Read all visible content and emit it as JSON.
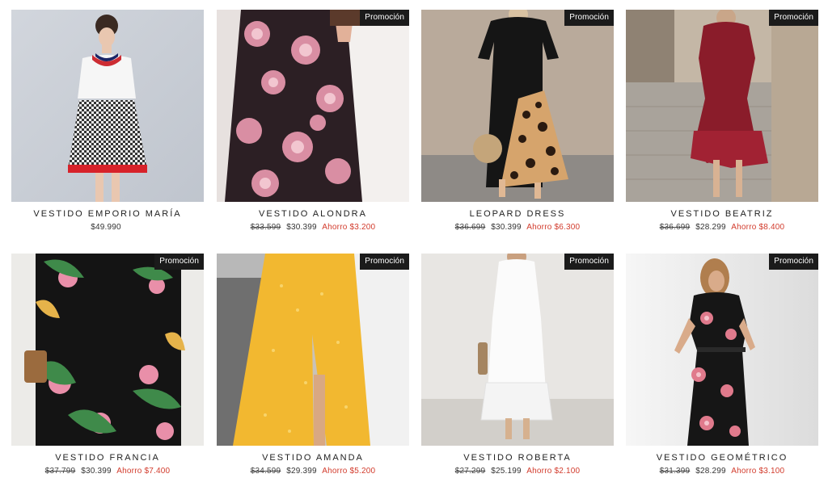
{
  "badge_label": "Promoción",
  "save_label": "Ahorro",
  "colors": {
    "badge_bg": "#1b1b1b",
    "save_text": "#d23b2c"
  },
  "products": [
    {
      "name": "VESTIDO EMPORIO MARÍA",
      "old_price": "",
      "price": "$49.990",
      "save": "",
      "promo": false
    },
    {
      "name": "VESTIDO ALONDRA",
      "old_price": "$33.599",
      "price": "$30.399",
      "save": "$3.200",
      "promo": true
    },
    {
      "name": "LEOPARD DRESS",
      "old_price": "$36.699",
      "price": "$30.399",
      "save": "$6.300",
      "promo": true
    },
    {
      "name": "VESTIDO BEATRIZ",
      "old_price": "$36.699",
      "price": "$28.299",
      "save": "$8.400",
      "promo": true
    },
    {
      "name": "VESTIDO FRANCIA",
      "old_price": "$37.799",
      "price": "$30.399",
      "save": "$7.400",
      "promo": true
    },
    {
      "name": "VESTIDO AMANDA",
      "old_price": "$34.599",
      "price": "$29.399",
      "save": "$5.200",
      "promo": true
    },
    {
      "name": "VESTIDO ROBERTA",
      "old_price": "$27.299",
      "price": "$25.199",
      "save": "$2.100",
      "promo": true
    },
    {
      "name": "VESTIDO GEOMÉTRICO",
      "old_price": "$31.399",
      "price": "$28.299",
      "save": "$3.100",
      "promo": true
    }
  ]
}
